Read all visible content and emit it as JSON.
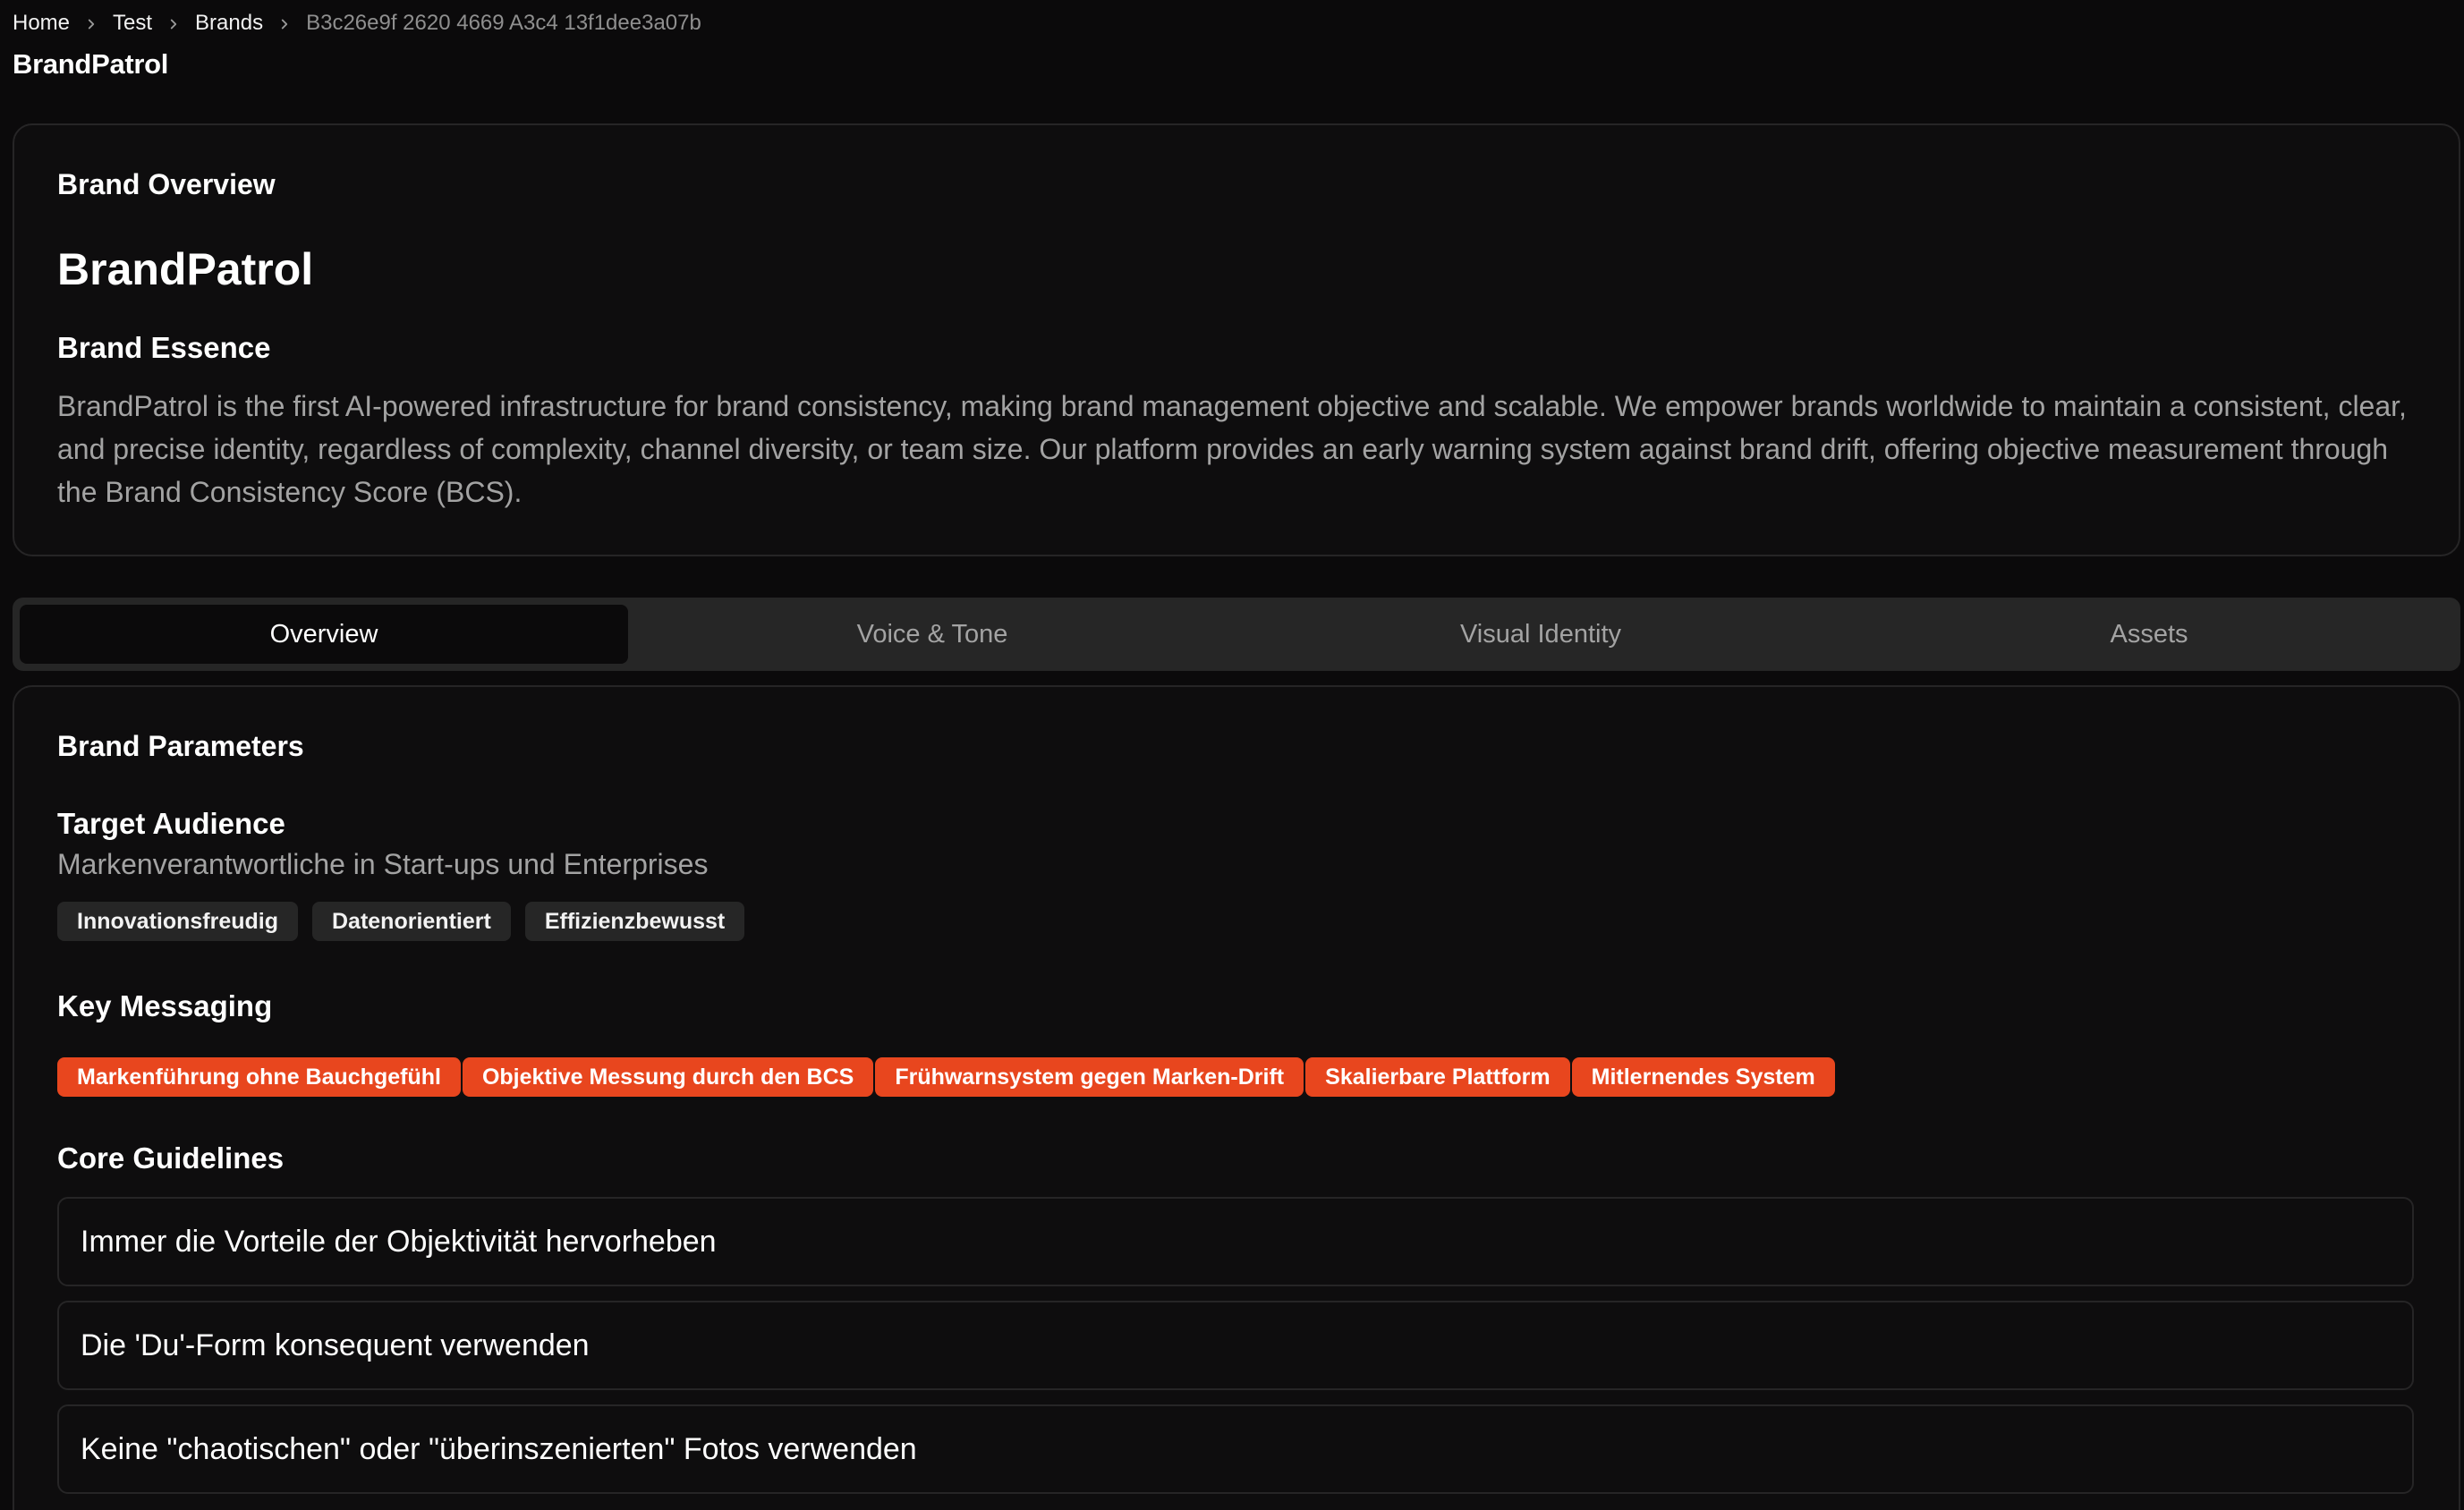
{
  "breadcrumb": {
    "items": [
      "Home",
      "Test",
      "Brands"
    ],
    "current": "B3c26e9f 2620 4669 A3c4 13f1dee3a07b"
  },
  "app_title": "BrandPatrol",
  "overview": {
    "heading": "Brand Overview",
    "brand_name": "BrandPatrol",
    "essence_label": "Brand Essence",
    "essence_text": "BrandPatrol is the first AI-powered infrastructure for brand consistency, making brand management objective and scalable. We empower brands worldwide to maintain a consistent, clear, and precise identity, regardless of complexity, channel diversity, or team size. Our platform provides an early warning system against brand drift, offering objective measurement through the Brand Consistency Score (BCS)."
  },
  "tabs": [
    {
      "label": "Overview",
      "active": true
    },
    {
      "label": "Voice & Tone",
      "active": false
    },
    {
      "label": "Visual Identity",
      "active": false
    },
    {
      "label": "Assets",
      "active": false
    }
  ],
  "parameters": {
    "heading": "Brand Parameters",
    "target_audience": {
      "label": "Target Audience",
      "description": "Markenverantwortliche in Start-ups und Enterprises",
      "traits": [
        "Innovationsfreudig",
        "Datenorientiert",
        "Effizienzbewusst"
      ]
    },
    "key_messaging": {
      "label": "Key Messaging",
      "messages": [
        "Markenführung ohne Bauchgefühl",
        "Objektive Messung durch den BCS",
        "Frühwarnsystem gegen Marken-Drift",
        "Skalierbare Plattform",
        "Mitlernendes System"
      ]
    },
    "core_guidelines": {
      "label": "Core Guidelines",
      "items": [
        "Immer die Vorteile der Objektivität hervorheben",
        "Die 'Du'-Form konsequent verwenden",
        "Keine \"chaotischen\" oder \"überinszenierten\" Fotos verwenden"
      ]
    }
  },
  "colors": {
    "background": "#0b0a0b",
    "accent": "#e8461e",
    "chip_gray": "#262626",
    "muted_text": "#a3a3a3"
  }
}
